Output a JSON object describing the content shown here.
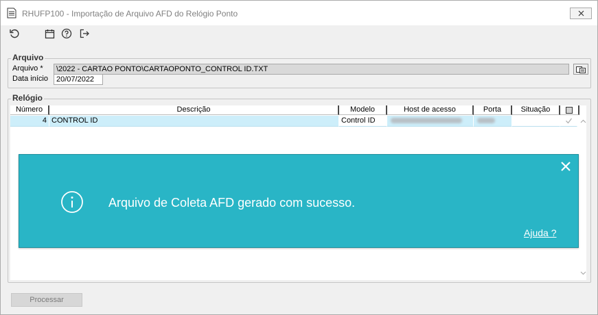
{
  "window": {
    "title": "RHUFP100 - Importação de Arquivo AFD do Relógio Ponto",
    "icons": {
      "app": "document-list-icon",
      "close": "close-icon"
    }
  },
  "toolbar": {
    "icons": [
      "refresh-icon",
      "calendar-icon",
      "help-circle-icon",
      "exit-icon"
    ]
  },
  "arquivo_section": {
    "legend": "Arquivo",
    "file_label": "Arquivo *",
    "file_value": "\\2022 - CARTAO PONTO\\CARTAOPONTO_CONTROL ID.TXT",
    "date_label": "Data início",
    "date_value": "20/07/2022",
    "browse_icon": "browse-file-icon"
  },
  "relogio_section": {
    "legend": "Relógio",
    "columns": [
      "Número",
      "Descrição",
      "Modelo",
      "Host de acesso",
      "Porta",
      "Situação"
    ],
    "rows": [
      {
        "numero": "4",
        "descricao": "CONTROL ID",
        "modelo": "Control ID",
        "host": "",
        "porta": "",
        "situacao": "",
        "checked": true
      }
    ]
  },
  "toast": {
    "message": "Arquivo de Coleta AFD gerado com sucesso.",
    "help_link": "Ajuda ?",
    "info_icon": "info-icon",
    "close_icon": "close-icon",
    "color": "#29b5c6"
  },
  "footer": {
    "process_label": "Processar"
  }
}
